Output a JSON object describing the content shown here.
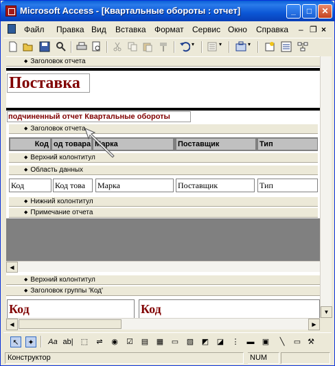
{
  "window": {
    "title": "Microsoft Access - [Квартальные обороты : отчет]",
    "minimize": "_",
    "maximize": "□",
    "close": "✕"
  },
  "menu": {
    "items": [
      "Файл",
      "Правка",
      "Вид",
      "Вставка",
      "Формат",
      "Сервис",
      "Окно",
      "Справка"
    ],
    "mdi_minimize": "–",
    "mdi_restore": "❐",
    "mdi_close": "×"
  },
  "toolbar": {
    "icons": [
      "new-icon",
      "open-icon",
      "save-icon",
      "search-icon",
      "print-icon",
      "print-preview-icon",
      "cut-icon",
      "copy-icon",
      "paste-icon",
      "format-painter-icon",
      "undo-icon",
      "field-list-icon",
      "toolbox-icon",
      "autoformat-icon",
      "properties-icon",
      "build-icon"
    ]
  },
  "report": {
    "bands": {
      "report_header": "Заголовок отчета",
      "sub_report_header": "Заголовок отчета",
      "sub_page_header": "Верхний колонтитул",
      "sub_detail": "Область данных",
      "sub_page_footer": "Нижний колонтитул",
      "sub_report_footer": "Примечание отчета",
      "page_header": "Верхний колонтитул",
      "group_header": "Заголовок группы 'Код'"
    },
    "title": "Поставка",
    "subreport_label": "подчиненный отчет Квартальные обороты",
    "header_cells": [
      "Код",
      "од товара",
      "Марка",
      "Поставщик",
      "Тип"
    ],
    "data_cells": [
      "Код",
      "Код това",
      "Марка",
      "Поставщик",
      "Тип"
    ],
    "group_fields": [
      "Код",
      "Код"
    ]
  },
  "toolbox": {
    "items": [
      "select-objects-icon",
      "control-wizards-icon",
      "label-icon",
      "text-box-icon",
      "option-group-icon",
      "toggle-button-icon",
      "option-button-icon",
      "check-box-icon",
      "combo-box-icon",
      "list-box-icon",
      "command-button-icon",
      "image-icon",
      "unbound-object-icon",
      "bound-object-icon",
      "page-break-icon",
      "tab-control-icon",
      "subform-icon",
      "line-icon",
      "rectangle-icon",
      "more-controls-icon"
    ]
  },
  "status": {
    "mode": "Конструктор",
    "num": "NUM"
  }
}
